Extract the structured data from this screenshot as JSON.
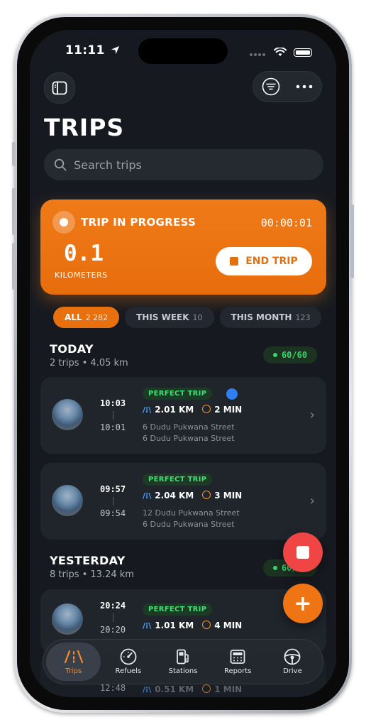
{
  "status": {
    "time": "11:11"
  },
  "page": {
    "title": "TRIPS"
  },
  "search": {
    "placeholder": "Search trips"
  },
  "active_trip": {
    "label": "TRIP IN PROGRESS",
    "timer": "00:00:01",
    "distance": "0.1",
    "unit": "KILOMETERS",
    "end_label": "END TRIP"
  },
  "filters": [
    {
      "label": "ALL",
      "count": "2 282",
      "active": true
    },
    {
      "label": "THIS WEEK",
      "count": "10",
      "active": false
    },
    {
      "label": "THIS MONTH",
      "count": "123",
      "active": false
    }
  ],
  "sections": [
    {
      "title": "TODAY",
      "summary": "2 trips • 4.05 km",
      "score": "60/60",
      "trips": [
        {
          "badge": "PERFECT TRIP",
          "start": "10:03",
          "end": "10:01",
          "distance": "2.01 KM",
          "duration": "2 MIN",
          "from": "6 Dudu Pukwana Street",
          "to": "6 Dudu Pukwana Street"
        },
        {
          "badge": "PERFECT TRIP",
          "start": "09:57",
          "end": "09:54",
          "distance": "2.04 KM",
          "duration": "3 MIN",
          "from": "12 Dudu Pukwana Street",
          "to": "6 Dudu Pukwana Street"
        }
      ]
    },
    {
      "title": "YESTERDAY",
      "summary": "8 trips • 13.24 km",
      "score": "60/60",
      "trips": [
        {
          "badge": "PERFECT TRIP",
          "start": "20:24",
          "end": "20:20",
          "distance": "1.01 KM",
          "duration": "4 MIN"
        },
        {
          "start": "12:48",
          "distance": "0.51 KM",
          "duration": "1 MIN"
        }
      ]
    }
  ],
  "tabs": [
    {
      "label": "Trips",
      "icon": "road-icon",
      "active": true
    },
    {
      "label": "Refuels",
      "icon": "gauge-icon",
      "active": false
    },
    {
      "label": "Stations",
      "icon": "fuel-pump-icon",
      "active": false
    },
    {
      "label": "Reports",
      "icon": "calculator-icon",
      "active": false
    },
    {
      "label": "Drive",
      "icon": "steering-wheel-icon",
      "active": false
    }
  ],
  "colors": {
    "accent": "#EF7514",
    "background": "#161A20",
    "stop": "#F04545",
    "success": "#38D56A"
  }
}
